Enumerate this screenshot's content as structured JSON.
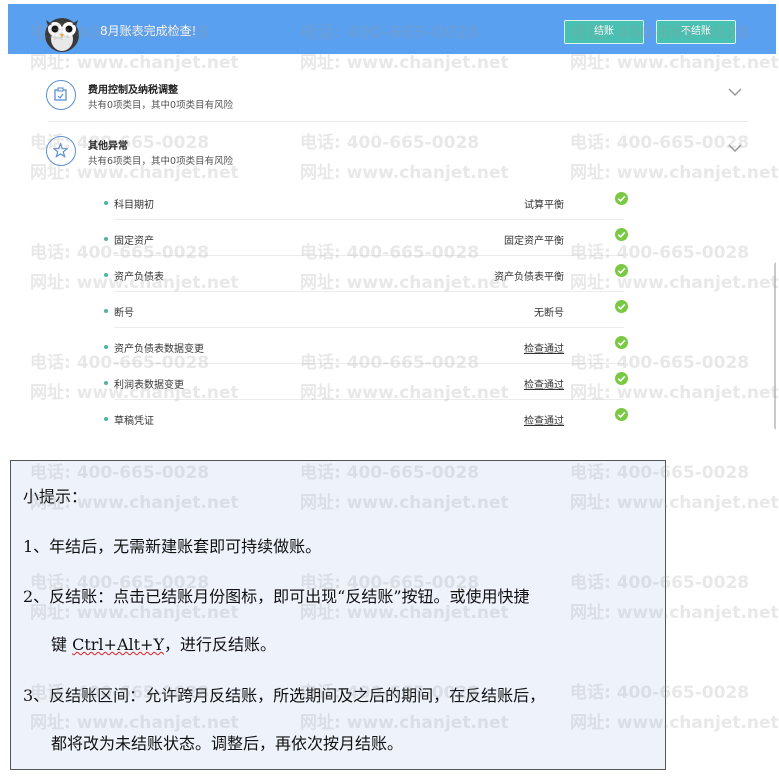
{
  "header": {
    "title": "8月账表完成检查!",
    "close_btn": "结账",
    "noclose_btn": "不结账"
  },
  "sections": [
    {
      "title": "费用控制及纳税调整",
      "subtitle": "共有0项类目，其中0项类目有风险",
      "icon": "clipboard-icon"
    },
    {
      "title": "其他异常",
      "subtitle": "共有6项类目，其中0项类目有风险",
      "icon": "star-icon"
    }
  ],
  "checks": [
    {
      "name": "科目期初",
      "status": "试算平衡",
      "link": false
    },
    {
      "name": "固定资产",
      "status": "固定资产平衡",
      "link": false
    },
    {
      "name": "资产负债表",
      "status": "资产负债表平衡",
      "link": false
    },
    {
      "name": "断号",
      "status": "无断号",
      "link": false
    },
    {
      "name": "资产负债表数据变更",
      "status": "检查通过",
      "link": true
    },
    {
      "name": "利润表数据变更",
      "status": "检查通过",
      "link": true
    },
    {
      "name": "草稿凭证",
      "status": "检查通过",
      "link": true
    }
  ],
  "tips": {
    "heading": "小提示：",
    "p1": "1、年结后，无需新建账套即可持续做账。",
    "p2a": "2、反结账：点击已结账月份图标，即可出现“反结账”按钮。或使用快捷",
    "p2b_pre": "键 ",
    "p2b_key": "Ctrl+Alt+Y",
    "p2b_post": "，进行反结账。",
    "p3a": "3、反结账区间：允许跨月反结账，所选期间及之后的期间，在反结账后，",
    "p3b": "都将改为未结账状态。调整后，再依次按月结账。"
  },
  "watermark": {
    "phone": "电话: 400-665-0028",
    "site": "网址: www.chanjet.net"
  },
  "colors": {
    "header": "#5aa0f0",
    "button": "#49c1b2",
    "check": "#7ac943",
    "tips_bg": "#eef2fb"
  }
}
